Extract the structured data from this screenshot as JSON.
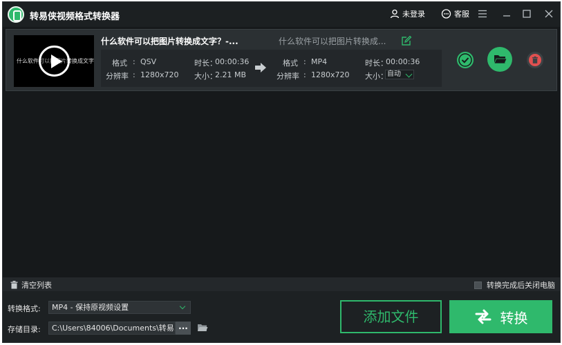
{
  "app": {
    "title": "转易侠视频格式转换器"
  },
  "titlebar": {
    "user_label": "未登录",
    "service_label": "客服",
    "icons": [
      "user-icon",
      "chat-icon",
      "menu-icon",
      "minimize-icon",
      "maximize-icon",
      "close-icon"
    ]
  },
  "file": {
    "thumbnail_text": "什么软件可以把图片转换成文字?",
    "source_title": "什么软件可以把图片转换成文字？-...",
    "target_title": "什么软件可以把图片转换成...",
    "source": {
      "format_label": "格式",
      "format_value": "QSV",
      "resolution_label": "分辨率",
      "resolution_value": "1280x720",
      "duration_label": "时长：",
      "duration_value": "00:00:36",
      "size_label": "大小：",
      "size_value": "2.21 MB"
    },
    "target": {
      "format_label": "格式",
      "format_value": "MP4",
      "resolution_label": "分辨率",
      "resolution_value": "1280x720",
      "duration_label": "时长：",
      "duration_value": "00:00:36",
      "size_label": "大小：",
      "size_value": "自动"
    }
  },
  "toolbar": {
    "clear_label": "清空列表",
    "shutdown_label": "转换完成后关闭电脑",
    "shutdown_checked": false
  },
  "settings": {
    "format_label": "转换格式:",
    "format_value": "MP4 - 保持原视频设置",
    "path_label": "存储目录:",
    "path_value": "C:\\Users\\84006\\Documents\\转易...",
    "browse_label": "..."
  },
  "actions": {
    "add_label": "添加文件",
    "convert_label": "转换"
  },
  "colors": {
    "accent": "#2fb96c",
    "background": "#16191b",
    "panel": "#2b3033"
  }
}
